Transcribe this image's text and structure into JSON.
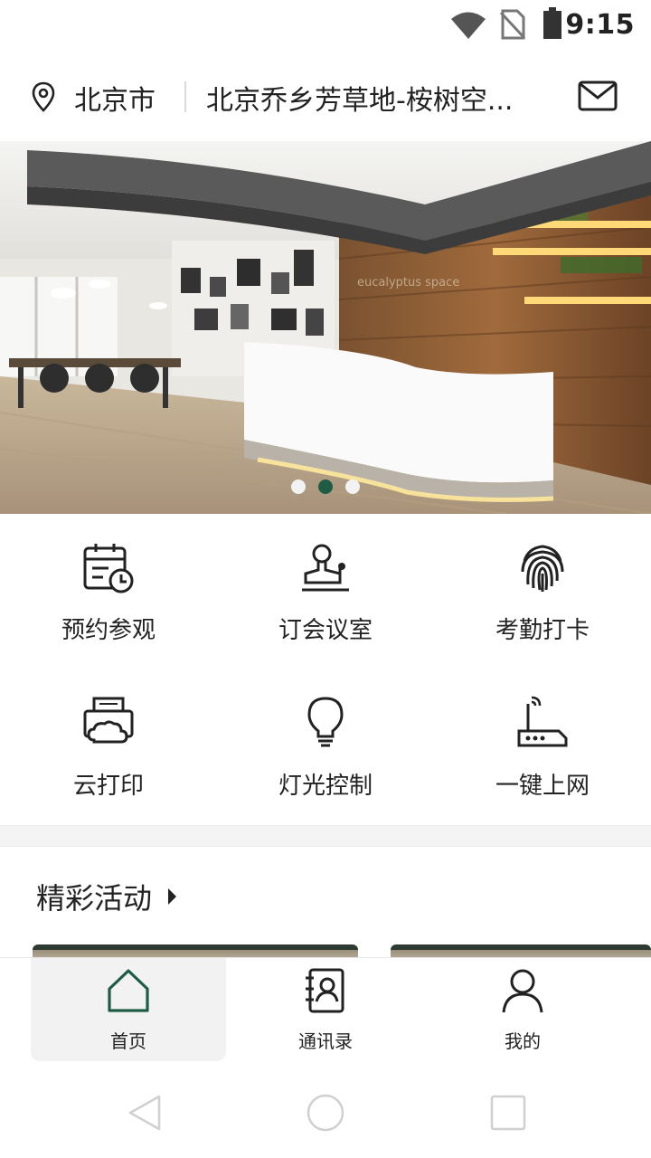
{
  "status_bar": {
    "time": "9:15",
    "icons": [
      "wifi-icon",
      "no-sim-icon",
      "battery-icon"
    ]
  },
  "header": {
    "city": "北京市",
    "site": "北京乔乡芳草地-桉树空...",
    "icons": [
      "location-pin-icon",
      "mail-icon"
    ]
  },
  "banner": {
    "dots": 3,
    "active_index": 1,
    "wall_text": "eucalyptus space"
  },
  "features": [
    {
      "label": "预约参观",
      "icon": "calendar-clock-icon"
    },
    {
      "label": "订会议室",
      "icon": "meeting-stamp-icon"
    },
    {
      "label": "考勤打卡",
      "icon": "fingerprint-icon"
    },
    {
      "label": "云打印",
      "icon": "cloud-printer-icon"
    },
    {
      "label": "灯光控制",
      "icon": "lightbulb-icon"
    },
    {
      "label": "一键上网",
      "icon": "router-icon"
    }
  ],
  "activities": {
    "title": "精彩活动"
  },
  "bottom_nav": [
    {
      "label": "首页",
      "icon": "home-icon",
      "active": true
    },
    {
      "label": "通讯录",
      "icon": "contacts-book-icon",
      "active": false
    },
    {
      "label": "我的",
      "icon": "user-icon",
      "active": false
    }
  ],
  "colors": {
    "accent": "#1f5c45",
    "nav_active_bg": "#f1f2f1",
    "separator": "#f4f4f4"
  }
}
